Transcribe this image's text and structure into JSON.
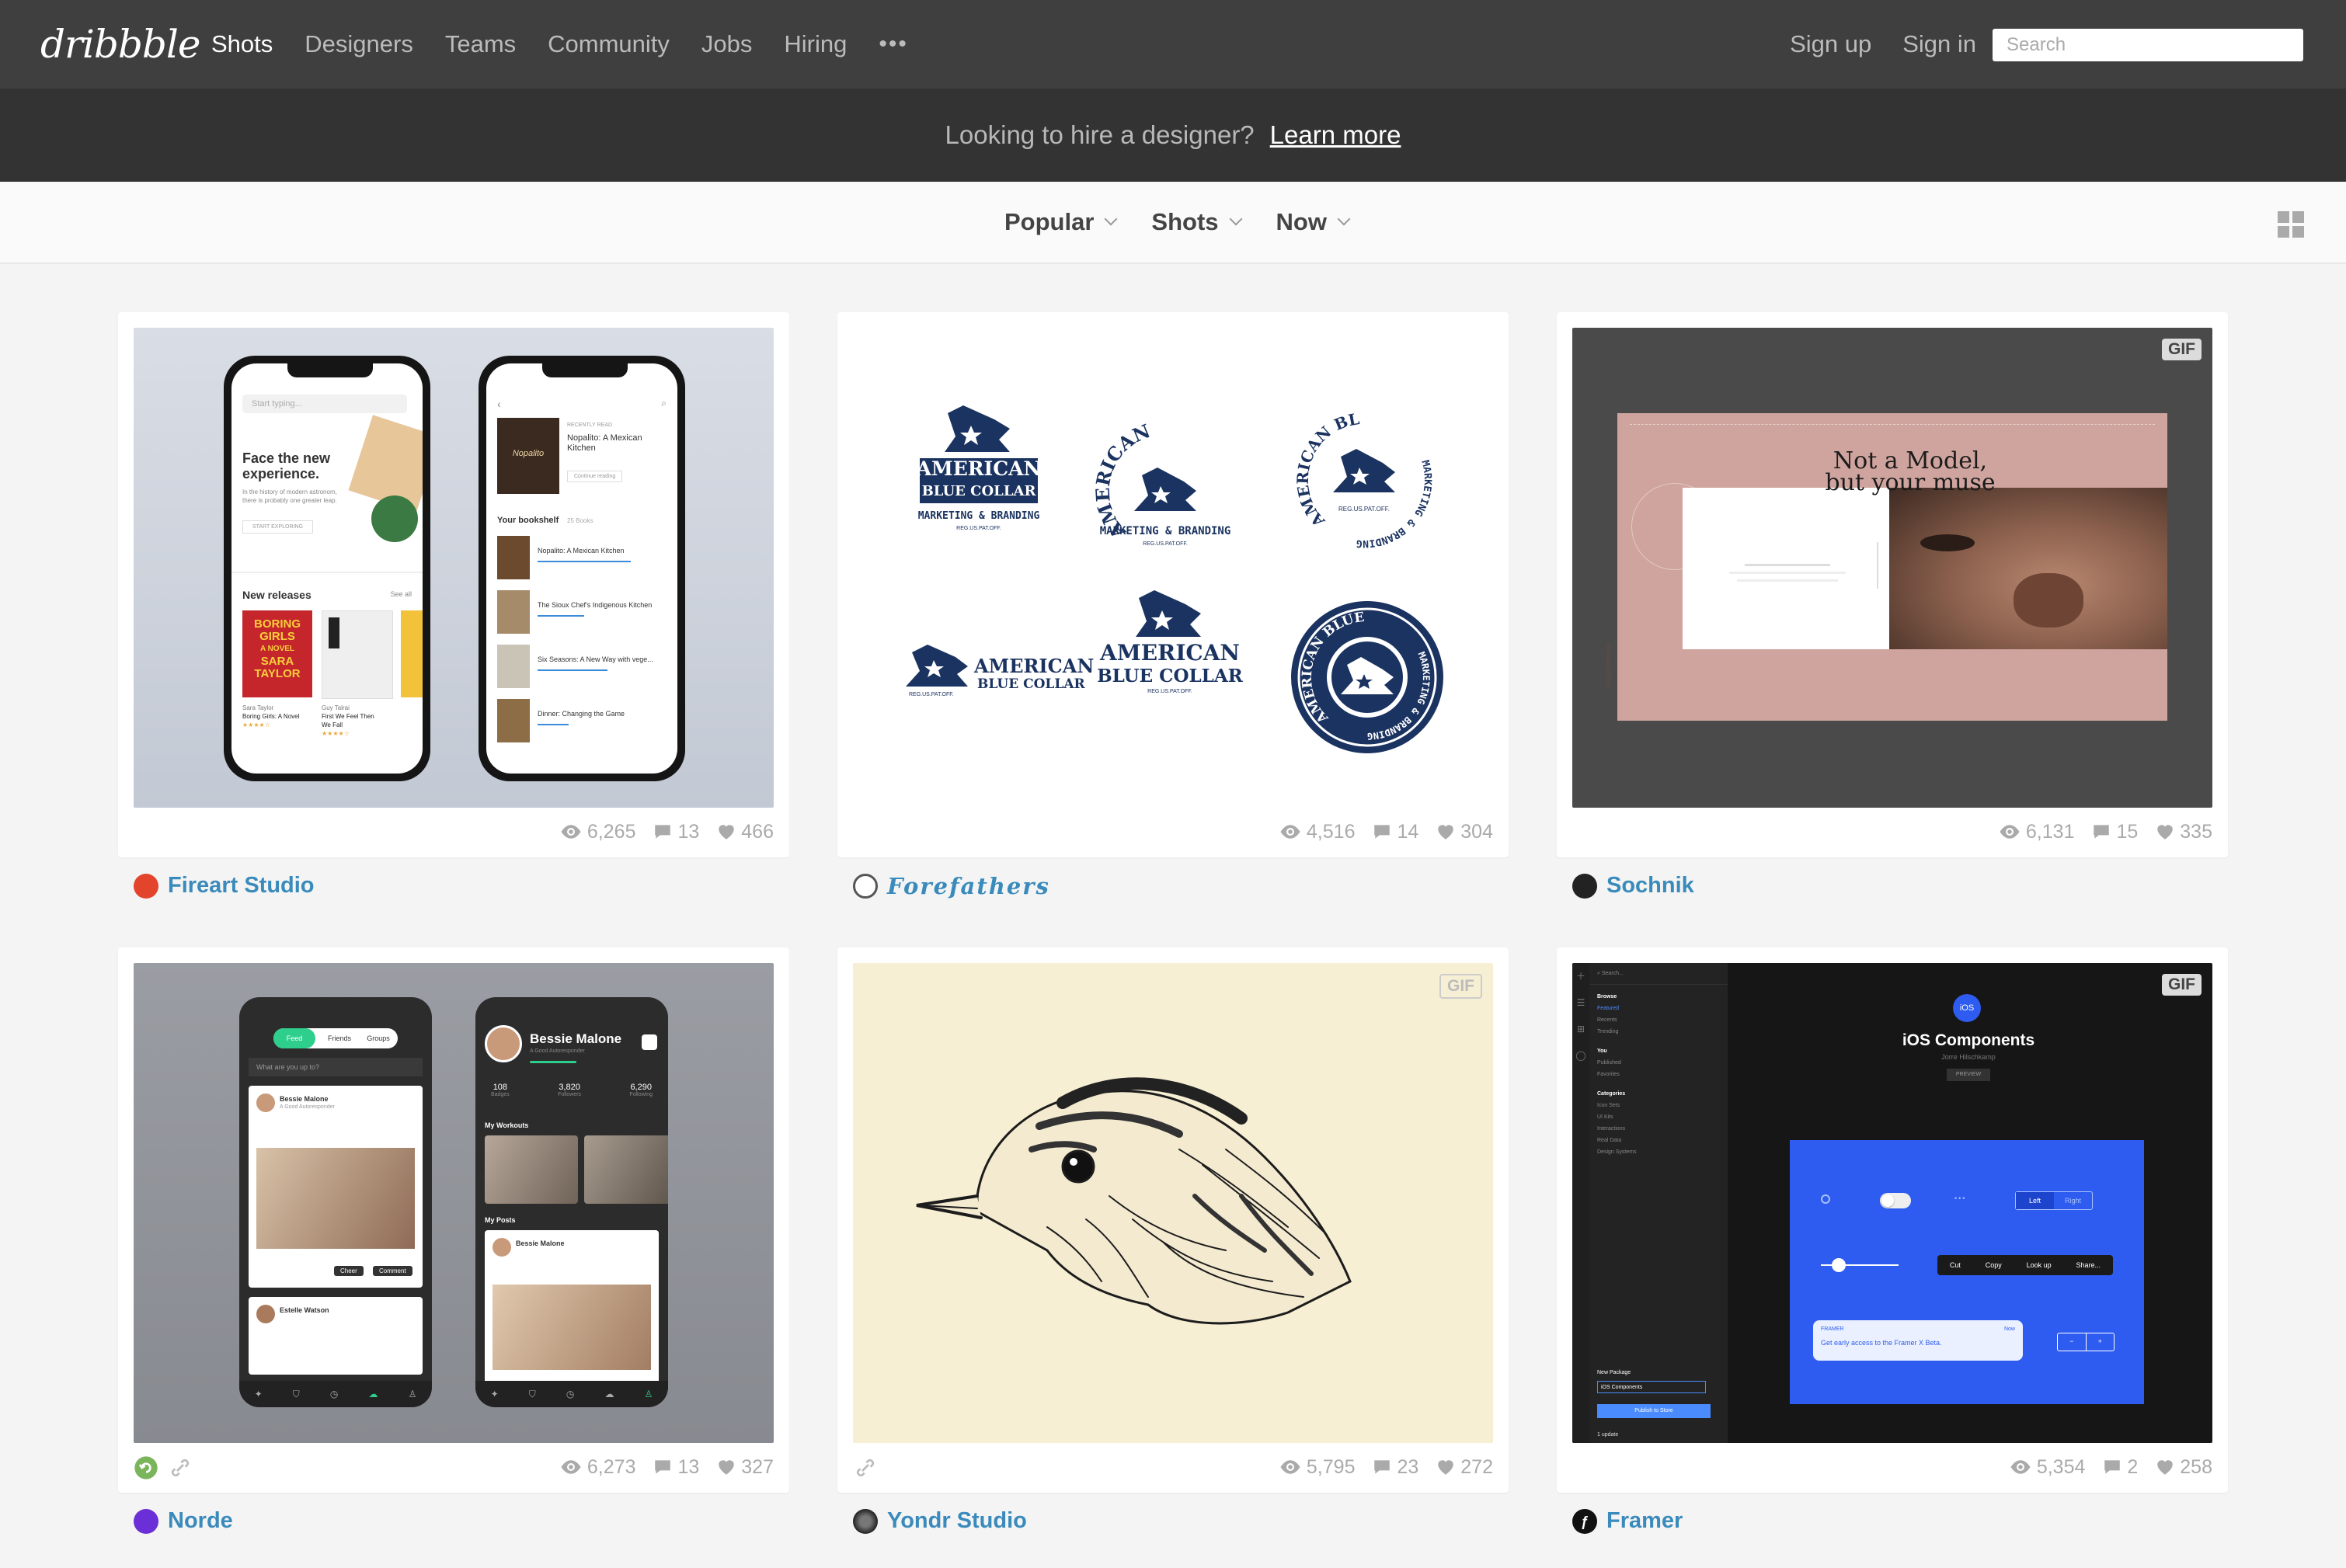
{
  "brand": {
    "logo": "dribbble"
  },
  "nav": {
    "items": [
      "Shots",
      "Designers",
      "Teams",
      "Community",
      "Jobs",
      "Hiring"
    ],
    "active": "Shots",
    "more_label": "•••",
    "sign_up": "Sign up",
    "sign_in": "Sign in",
    "search_placeholder": "Search"
  },
  "banner": {
    "text": "Looking to hire a designer?",
    "link": "Learn more"
  },
  "filters": [
    "Popular",
    "Shots",
    "Now"
  ],
  "shots": [
    {
      "author": "Fireart Studio",
      "views": "6,265",
      "comments": "13",
      "likes": "466",
      "badge": "",
      "colors": {
        "bg": "#ccd2dc",
        "avatar": "#e2452c"
      },
      "content": {
        "left_phone": [
          "Start typing...",
          "Face the new",
          "experience.",
          "In the history of modern astronom,",
          "there is probably one greater leap.",
          "START EXPLORING",
          "New releases",
          "See all",
          "BORING",
          "GIRLS",
          "A NOVEL",
          "SARA",
          "TAYLOR",
          "Sara Taylor",
          "Boring Girls: A Novel",
          "Guy Talrai",
          "First We Feel Then",
          "We Fall"
        ],
        "right_phone": [
          "RECENTLY READ",
          "Nopalito: A Mexican",
          "Kitchen",
          "Continue reading",
          "Your bookshelf",
          "25 Books",
          "Nopalito: A Mexican Kitchen",
          "The Sioux Chef's Indigenous Kitchen",
          "Six Seasons: A New Way with vege...",
          "Dinner: Changing the Game",
          "Nopalito"
        ]
      }
    },
    {
      "author": "Forefathers",
      "views": "4,516",
      "comments": "14",
      "likes": "304",
      "badge": "",
      "colors": {
        "bg": "#ffffff",
        "avatar": "#555555",
        "brand": "#1b3360"
      },
      "content": {
        "wordmark_1": "AMERICAN",
        "wordmark_2": "BLUE COLLAR",
        "tagline": "MARKETING & BRANDING",
        "reg": "REG.US.PAT.OFF.",
        "ring": "AMERICAN BLUE COLLAR",
        "ring_small": "MARKETING & BRANDING"
      }
    },
    {
      "author": "Sochnik",
      "views": "6,131",
      "comments": "15",
      "likes": "335",
      "badge": "GIF",
      "colors": {
        "bg": "#4a4a4a",
        "panel": "#cfa49e",
        "avatar": "#222222"
      },
      "content": {
        "headline_1": "Not a Model,",
        "headline_2": "but your muse",
        "side": "Social Networks"
      }
    },
    {
      "author": "Norde",
      "views": "6,273",
      "comments": "13",
      "likes": "327",
      "badge": "",
      "colors": {
        "bg": "#8f9298",
        "avatar": "#6a2fd6",
        "accent": "#2ecf8c"
      },
      "content": {
        "tabs": [
          "Feed",
          "Friends",
          "Groups"
        ],
        "status_placeholder": "What are you up to?",
        "name": "Bessie Malone",
        "subtitle": "A Good Autoresponder",
        "stats": [
          "108",
          "3,820",
          "6,290"
        ],
        "stat_labels": [
          "Badges",
          "Followers",
          "Following"
        ],
        "section_workouts": "My Workouts",
        "section_posts": "My Posts",
        "cheer": "Cheer",
        "comment": "Comment",
        "name2": "Estelle Watson"
      }
    },
    {
      "author": "Yondr Studio",
      "views": "5,795",
      "comments": "23",
      "likes": "272",
      "badge": "GIF",
      "colors": {
        "bg": "#f7efd3",
        "avatar": "#333333"
      },
      "content": {}
    },
    {
      "author": "Framer",
      "views": "5,354",
      "comments": "2",
      "likes": "258",
      "badge": "GIF",
      "colors": {
        "bg": "#161616",
        "panel": "#2e5cf0",
        "avatar": "#111111"
      },
      "content": {
        "search": "Search...",
        "sidebar_sections": [
          "Browse",
          "Featured",
          "Recents",
          "Trending",
          "You",
          "Published",
          "Favorites",
          "Categories",
          "Icon Sets",
          "UI Kits",
          "Interactions",
          "Real Data",
          "Design Systems"
        ],
        "ios_badge": "iOS",
        "title": "iOS Components",
        "by": "Jorre Hilschkamp",
        "preview": "PREVIEW",
        "seg": [
          "Left",
          "Right"
        ],
        "menu": [
          "Cut",
          "Copy",
          "Look up",
          "Share..."
        ],
        "toast_app": "FRAMER",
        "toast_time": "Now",
        "toast_text": "Get early access to the Framer X Beta.",
        "new_package": "New Package",
        "package_name": "iOS Components",
        "publish": "Publish to Store",
        "update": "1 update"
      }
    }
  ]
}
